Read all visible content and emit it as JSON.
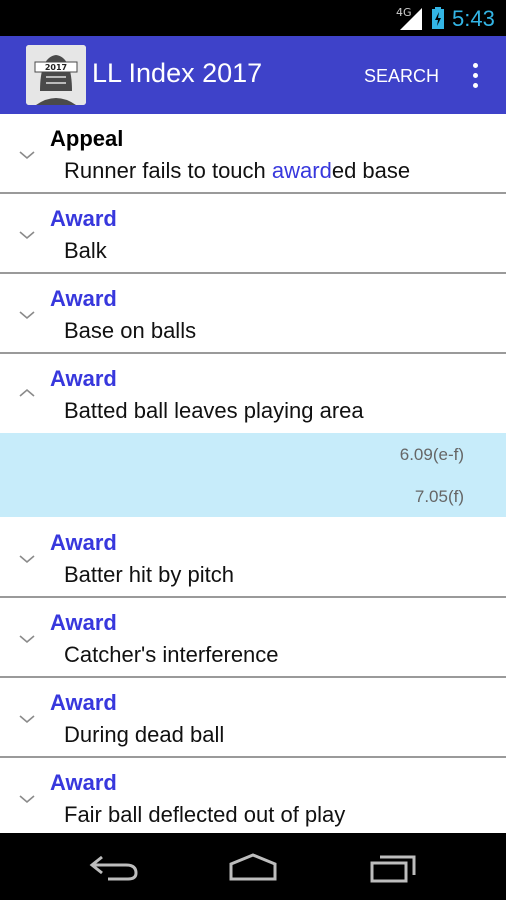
{
  "status_bar": {
    "network": "4G",
    "time": "5:43"
  },
  "action_bar": {
    "title": "LL Index 2017",
    "search_label": "SEARCH",
    "icon_text": "2017"
  },
  "list": [
    {
      "heading": "Appeal",
      "sub_before": "Runner fails to touch ",
      "sub_highlight": "award",
      "sub_after": "ed base"
    },
    {
      "heading": "Award",
      "sub": "Balk"
    },
    {
      "heading": "Award",
      "sub": "Base on balls"
    },
    {
      "heading": "Award",
      "sub": "Batted ball leaves playing area",
      "refs": [
        "6.09(e-f)",
        "7.05(f)"
      ]
    },
    {
      "heading": "Award",
      "sub": "Batter hit by pitch"
    },
    {
      "heading": "Award",
      "sub": "Catcher's interference"
    },
    {
      "heading": "Award",
      "sub": "During dead ball"
    },
    {
      "heading": "Award",
      "sub": "Fair ball deflected out of play"
    }
  ],
  "colors": {
    "action_bar": "#3e42c9",
    "heading_blue": "#3838dd",
    "expanded_bg": "#c7ecfa",
    "clock": "#33b5e5"
  },
  "icons": [
    "signal-icon",
    "battery-icon",
    "app-logo-icon",
    "overflow-menu-icon",
    "chevron-down-icon",
    "chevron-up-icon",
    "back-icon",
    "home-icon",
    "recent-apps-icon"
  ]
}
